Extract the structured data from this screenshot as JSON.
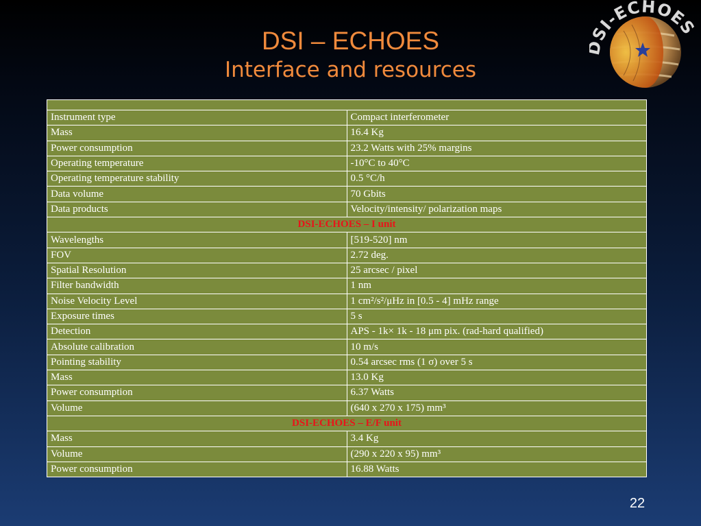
{
  "slide": {
    "title": "DSI – ECHOES",
    "subtitle": "Interface and resources",
    "page_number": "22"
  },
  "logo": {
    "text": "DSI-ECHOES",
    "icon": "jupiter-logo-icon",
    "colors": {
      "ring": "#d8d8d8",
      "planet_band": "#c89a5a",
      "core": "#e8a020",
      "star": "#2a3f9a"
    }
  },
  "table": {
    "header_blank": "",
    "rows_general": [
      {
        "label": "Instrument type",
        "value": "Compact interferometer"
      },
      {
        "label": "Mass",
        "value": "16.4 Kg"
      },
      {
        "label": "Power consumption",
        "value": "23.2 Watts with 25% margins"
      },
      {
        "label": "Operating temperature",
        "value": "-10°C to  40°C"
      },
      {
        "label": "Operating temperature stability",
        "value": "0.5 °C/h"
      },
      {
        "label": "Data volume",
        "value": "70 Gbits"
      },
      {
        "label": "Data products",
        "value": "Velocity/intensity/ polarization maps"
      }
    ],
    "section_i": "DSI-ECHOES – I unit",
    "rows_i": [
      {
        "label": "Wavelengths",
        "value": " [519-520]  nm"
      },
      {
        "label": "FOV",
        "value": " 2.72 deg."
      },
      {
        "label": "Spatial Resolution",
        "value": " 25 arcsec / pixel"
      },
      {
        "label": "Filter bandwidth",
        "value": " 1 nm"
      },
      {
        "label": "Noise Velocity Level",
        "value": " 1 cm²/s²/μHz in [0.5 - 4] mHz range"
      },
      {
        "label": "Exposure times",
        "value": " 5 s"
      },
      {
        "label": "Detection",
        "value": " APS - 1k× 1k - 18 μm pix. (rad-hard qualified)"
      },
      {
        "label": "Absolute calibration",
        "value": " 10 m/s"
      },
      {
        "label": "Pointing stability",
        "value": " 0.54 arcsec rms (1 σ) over 5 s"
      },
      {
        "label": "Mass",
        "value": "  13.0 Kg"
      },
      {
        "label": "Power consumption",
        "value": "6.37 Watts"
      },
      {
        "label": "Volume",
        "value": " (640 x 270 x 175) mm³"
      }
    ],
    "section_ef": "DSI-ECHOES – E/F unit",
    "rows_ef": [
      {
        "label": "Mass",
        "value": "  3.4 Kg"
      },
      {
        "label": "Volume",
        "value": " (290 x 220 x 95) mm³"
      },
      {
        "label": "Power consumption",
        "value": "  16.88 Watts"
      }
    ],
    "colors": {
      "cell_bg": "#7b8b3c",
      "border": "#ffffff",
      "section_text": "#e8141a",
      "text": "#ffffff"
    }
  }
}
